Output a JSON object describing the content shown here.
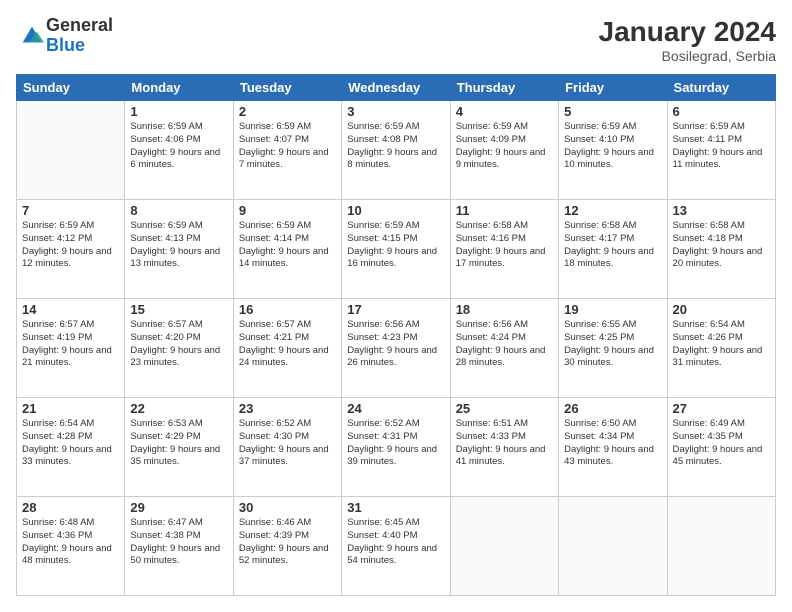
{
  "logo": {
    "general": "General",
    "blue": "Blue"
  },
  "title": {
    "month_year": "January 2024",
    "location": "Bosilegrad, Serbia"
  },
  "days_of_week": [
    "Sunday",
    "Monday",
    "Tuesday",
    "Wednesday",
    "Thursday",
    "Friday",
    "Saturday"
  ],
  "weeks": [
    [
      {
        "day": "",
        "sunrise": "",
        "sunset": "",
        "daylight": ""
      },
      {
        "day": "1",
        "sunrise": "Sunrise: 6:59 AM",
        "sunset": "Sunset: 4:06 PM",
        "daylight": "Daylight: 9 hours and 6 minutes."
      },
      {
        "day": "2",
        "sunrise": "Sunrise: 6:59 AM",
        "sunset": "Sunset: 4:07 PM",
        "daylight": "Daylight: 9 hours and 7 minutes."
      },
      {
        "day": "3",
        "sunrise": "Sunrise: 6:59 AM",
        "sunset": "Sunset: 4:08 PM",
        "daylight": "Daylight: 9 hours and 8 minutes."
      },
      {
        "day": "4",
        "sunrise": "Sunrise: 6:59 AM",
        "sunset": "Sunset: 4:09 PM",
        "daylight": "Daylight: 9 hours and 9 minutes."
      },
      {
        "day": "5",
        "sunrise": "Sunrise: 6:59 AM",
        "sunset": "Sunset: 4:10 PM",
        "daylight": "Daylight: 9 hours and 10 minutes."
      },
      {
        "day": "6",
        "sunrise": "Sunrise: 6:59 AM",
        "sunset": "Sunset: 4:11 PM",
        "daylight": "Daylight: 9 hours and 11 minutes."
      }
    ],
    [
      {
        "day": "7",
        "sunrise": "Sunrise: 6:59 AM",
        "sunset": "Sunset: 4:12 PM",
        "daylight": "Daylight: 9 hours and 12 minutes."
      },
      {
        "day": "8",
        "sunrise": "Sunrise: 6:59 AM",
        "sunset": "Sunset: 4:13 PM",
        "daylight": "Daylight: 9 hours and 13 minutes."
      },
      {
        "day": "9",
        "sunrise": "Sunrise: 6:59 AM",
        "sunset": "Sunset: 4:14 PM",
        "daylight": "Daylight: 9 hours and 14 minutes."
      },
      {
        "day": "10",
        "sunrise": "Sunrise: 6:59 AM",
        "sunset": "Sunset: 4:15 PM",
        "daylight": "Daylight: 9 hours and 16 minutes."
      },
      {
        "day": "11",
        "sunrise": "Sunrise: 6:58 AM",
        "sunset": "Sunset: 4:16 PM",
        "daylight": "Daylight: 9 hours and 17 minutes."
      },
      {
        "day": "12",
        "sunrise": "Sunrise: 6:58 AM",
        "sunset": "Sunset: 4:17 PM",
        "daylight": "Daylight: 9 hours and 18 minutes."
      },
      {
        "day": "13",
        "sunrise": "Sunrise: 6:58 AM",
        "sunset": "Sunset: 4:18 PM",
        "daylight": "Daylight: 9 hours and 20 minutes."
      }
    ],
    [
      {
        "day": "14",
        "sunrise": "Sunrise: 6:57 AM",
        "sunset": "Sunset: 4:19 PM",
        "daylight": "Daylight: 9 hours and 21 minutes."
      },
      {
        "day": "15",
        "sunrise": "Sunrise: 6:57 AM",
        "sunset": "Sunset: 4:20 PM",
        "daylight": "Daylight: 9 hours and 23 minutes."
      },
      {
        "day": "16",
        "sunrise": "Sunrise: 6:57 AM",
        "sunset": "Sunset: 4:21 PM",
        "daylight": "Daylight: 9 hours and 24 minutes."
      },
      {
        "day": "17",
        "sunrise": "Sunrise: 6:56 AM",
        "sunset": "Sunset: 4:23 PM",
        "daylight": "Daylight: 9 hours and 26 minutes."
      },
      {
        "day": "18",
        "sunrise": "Sunrise: 6:56 AM",
        "sunset": "Sunset: 4:24 PM",
        "daylight": "Daylight: 9 hours and 28 minutes."
      },
      {
        "day": "19",
        "sunrise": "Sunrise: 6:55 AM",
        "sunset": "Sunset: 4:25 PM",
        "daylight": "Daylight: 9 hours and 30 minutes."
      },
      {
        "day": "20",
        "sunrise": "Sunrise: 6:54 AM",
        "sunset": "Sunset: 4:26 PM",
        "daylight": "Daylight: 9 hours and 31 minutes."
      }
    ],
    [
      {
        "day": "21",
        "sunrise": "Sunrise: 6:54 AM",
        "sunset": "Sunset: 4:28 PM",
        "daylight": "Daylight: 9 hours and 33 minutes."
      },
      {
        "day": "22",
        "sunrise": "Sunrise: 6:53 AM",
        "sunset": "Sunset: 4:29 PM",
        "daylight": "Daylight: 9 hours and 35 minutes."
      },
      {
        "day": "23",
        "sunrise": "Sunrise: 6:52 AM",
        "sunset": "Sunset: 4:30 PM",
        "daylight": "Daylight: 9 hours and 37 minutes."
      },
      {
        "day": "24",
        "sunrise": "Sunrise: 6:52 AM",
        "sunset": "Sunset: 4:31 PM",
        "daylight": "Daylight: 9 hours and 39 minutes."
      },
      {
        "day": "25",
        "sunrise": "Sunrise: 6:51 AM",
        "sunset": "Sunset: 4:33 PM",
        "daylight": "Daylight: 9 hours and 41 minutes."
      },
      {
        "day": "26",
        "sunrise": "Sunrise: 6:50 AM",
        "sunset": "Sunset: 4:34 PM",
        "daylight": "Daylight: 9 hours and 43 minutes."
      },
      {
        "day": "27",
        "sunrise": "Sunrise: 6:49 AM",
        "sunset": "Sunset: 4:35 PM",
        "daylight": "Daylight: 9 hours and 45 minutes."
      }
    ],
    [
      {
        "day": "28",
        "sunrise": "Sunrise: 6:48 AM",
        "sunset": "Sunset: 4:36 PM",
        "daylight": "Daylight: 9 hours and 48 minutes."
      },
      {
        "day": "29",
        "sunrise": "Sunrise: 6:47 AM",
        "sunset": "Sunset: 4:38 PM",
        "daylight": "Daylight: 9 hours and 50 minutes."
      },
      {
        "day": "30",
        "sunrise": "Sunrise: 6:46 AM",
        "sunset": "Sunset: 4:39 PM",
        "daylight": "Daylight: 9 hours and 52 minutes."
      },
      {
        "day": "31",
        "sunrise": "Sunrise: 6:45 AM",
        "sunset": "Sunset: 4:40 PM",
        "daylight": "Daylight: 9 hours and 54 minutes."
      },
      {
        "day": "",
        "sunrise": "",
        "sunset": "",
        "daylight": ""
      },
      {
        "day": "",
        "sunrise": "",
        "sunset": "",
        "daylight": ""
      },
      {
        "day": "",
        "sunrise": "",
        "sunset": "",
        "daylight": ""
      }
    ]
  ]
}
